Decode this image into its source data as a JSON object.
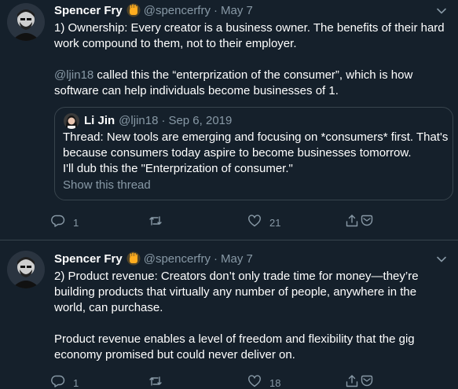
{
  "tweets": [
    {
      "author": {
        "name": "Spencer Fry",
        "handle": "@spencerfry"
      },
      "separator": "·",
      "date": "May 7",
      "body": {
        "line1": "1) Ownership: Every creator is a business owner. The benefits of their hard work compound to them, not to their employer.",
        "mention": "@ljin18",
        "line2_rest": " called this the “enterprization of the consumer”, which is how software can help individuals become businesses of 1."
      },
      "quote": {
        "author": {
          "name": "Li Jin",
          "handle": "@ljin18"
        },
        "separator": "·",
        "date": "Sep 6, 2019",
        "lines": [
          "Thread: New tools are emerging and focusing on *consumers* first. That's",
          "because consumers today aspire to become businesses tomorrow.",
          "I'll dub this the \"Enterprization of consumer.\""
        ],
        "show_thread": "Show this thread"
      },
      "actions": {
        "reply_count": "1",
        "retweet_count": "",
        "like_count": "21"
      }
    },
    {
      "author": {
        "name": "Spencer Fry",
        "handle": "@spencerfry"
      },
      "separator": "·",
      "date": "May 7",
      "body": {
        "p1": "2) Product revenue: Creators don’t only trade time for money—they’re building products that virtually any number of people, anywhere in the world, can purchase.",
        "p2": "Product revenue enables a level of freedom and flexibility that the gig economy promised but could never deliver on."
      },
      "actions": {
        "reply_count": "1",
        "retweet_count": "",
        "like_count": "18"
      }
    }
  ],
  "colors": {
    "background": "#15202b",
    "secondary_text": "#8899a6",
    "border": "#38444d",
    "badge": "#ffad1f"
  },
  "icons": {
    "badge": "hand-icon",
    "caret": "chevron-down-icon",
    "reply": "reply-icon",
    "retweet": "retweet-icon",
    "like": "heart-icon",
    "share": "share-icon",
    "dm": "message-icon"
  }
}
